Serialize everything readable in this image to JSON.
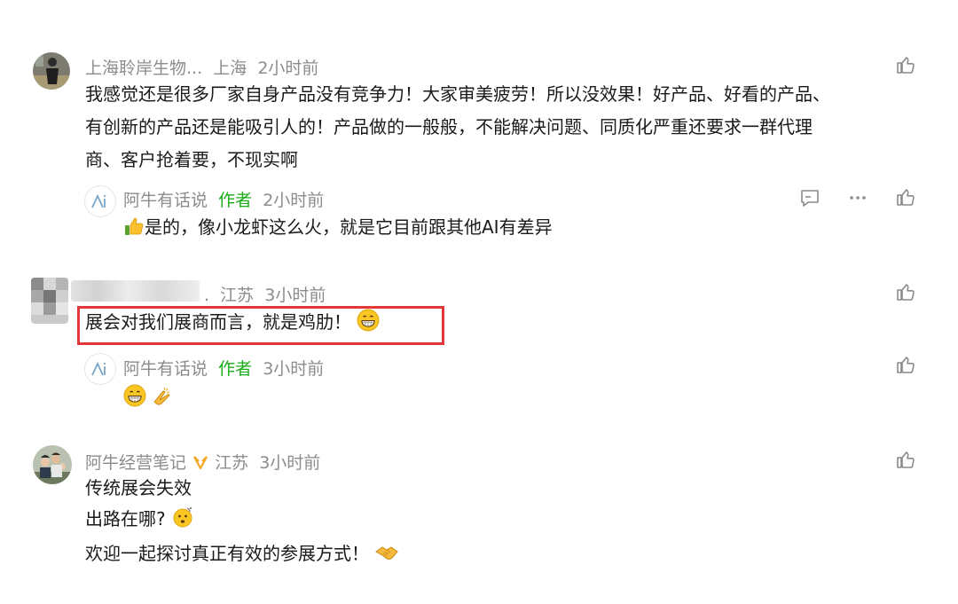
{
  "comments": [
    {
      "user": "上海聆岸生物...",
      "location": "上海",
      "time": "2小时前",
      "lines": [
        "我感觉还是很多厂家自身产品没有竞争力！大家审美疲劳！所以没效果！好产品、好看的产品、",
        "有创新的产品还是能吸引人的！产品做的一般般，不能解决问题、同质化严重还要求一群代理",
        "商、客户抢着要，不现实啊"
      ],
      "reply": {
        "user": "阿牛有话说",
        "tag": "作者",
        "time": "2小时前",
        "text": "是的，像小龙虾这么火，就是它目前跟其他AI有差异",
        "leading_icon": "thumbs-up-emoji"
      }
    },
    {
      "user": ".",
      "location": "江苏",
      "time": "3小时前",
      "text": "展会对我们展商而言，就是鸡肋！",
      "trailing_icon": "grin-emoji",
      "highlight_color": "#e2373b",
      "reply": {
        "user": "阿牛有话说",
        "tag": "作者",
        "time": "3小时前",
        "icons": [
          "grin-emoji",
          "clap-emoji"
        ]
      }
    },
    {
      "user": "阿牛经营笔记",
      "location": "江苏",
      "time": "3小时前",
      "lines": [
        "传统展会失效",
        "出路在哪?",
        "欢迎一起探讨真正有效的参展方式！"
      ],
      "line_icons": [
        "",
        "thinking-emoji",
        "handshake-emoji"
      ]
    }
  ],
  "colors": {
    "meta": "#8c8c8c",
    "author_tag": "#1aad19",
    "text": "#1a1a1a",
    "highlight": "#e2373b",
    "verified_badge": "#f5a623"
  }
}
